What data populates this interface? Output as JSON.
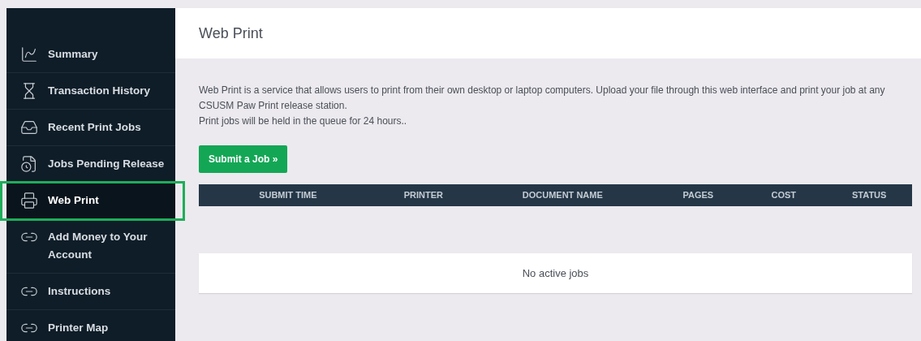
{
  "sidebar": {
    "items": [
      {
        "label": "Summary",
        "kind": "chart",
        "selected": false
      },
      {
        "label": "Transaction History",
        "kind": "history",
        "selected": false
      },
      {
        "label": "Recent Print Jobs",
        "kind": "recent",
        "selected": false
      },
      {
        "label": "Jobs Pending Release",
        "kind": "pending",
        "selected": false
      },
      {
        "label": "Web Print",
        "kind": "webprint",
        "selected": true
      },
      {
        "label": "Add Money to Your Account",
        "kind": "link",
        "selected": false
      },
      {
        "label": "Instructions",
        "kind": "link",
        "selected": false
      },
      {
        "label": "Printer Map",
        "kind": "link",
        "selected": false
      }
    ]
  },
  "page": {
    "title": "Web Print",
    "description": [
      "Web Print is a service that allows users to print from their own desktop or laptop computers. Upload your file through this web interface and print your job at any CSUSM Paw Print release station.",
      "Print jobs will be held in the queue for 24 hours.."
    ],
    "submit_button": "Submit a Job »",
    "table": {
      "columns": [
        "SUBMIT TIME",
        "PRINTER",
        "DOCUMENT NAME",
        "PAGES",
        "COST",
        "STATUS"
      ],
      "empty_message": "No active jobs"
    }
  }
}
